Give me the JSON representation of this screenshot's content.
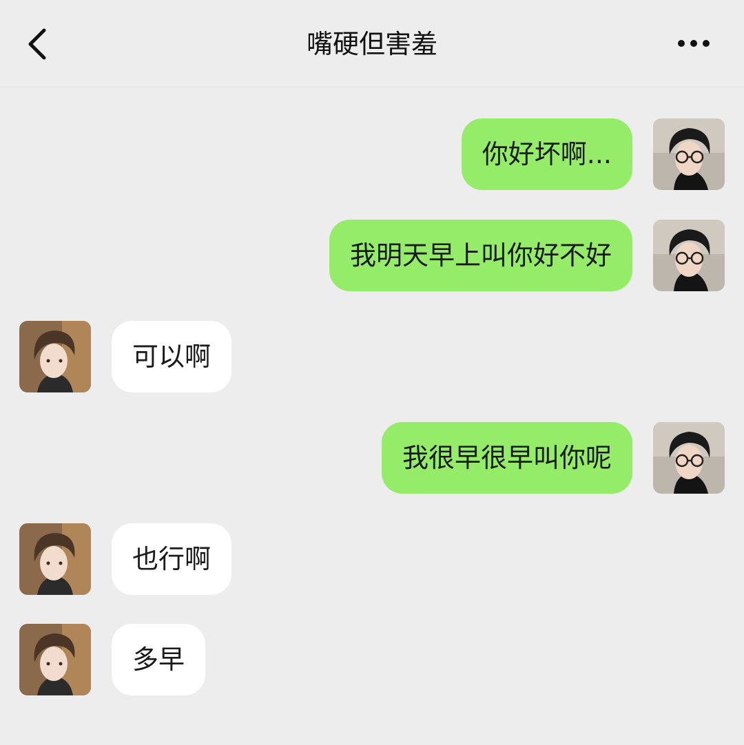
{
  "header": {
    "title": "嘴硬但害羞",
    "back_icon": "chevron-left-icon",
    "more_icon": "more-dots-icon"
  },
  "colors": {
    "background": "#ededed",
    "sent_bubble": "#95ec69",
    "received_bubble": "#ffffff"
  },
  "messages": [
    {
      "side": "me",
      "text": "你好坏啊..."
    },
    {
      "side": "me",
      "text": "我明天早上叫你好不好"
    },
    {
      "side": "them",
      "text": "可以啊"
    },
    {
      "side": "me",
      "text": "我很早很早叫你呢"
    },
    {
      "side": "them",
      "text": "也行啊"
    },
    {
      "side": "them",
      "text": "多早"
    }
  ]
}
